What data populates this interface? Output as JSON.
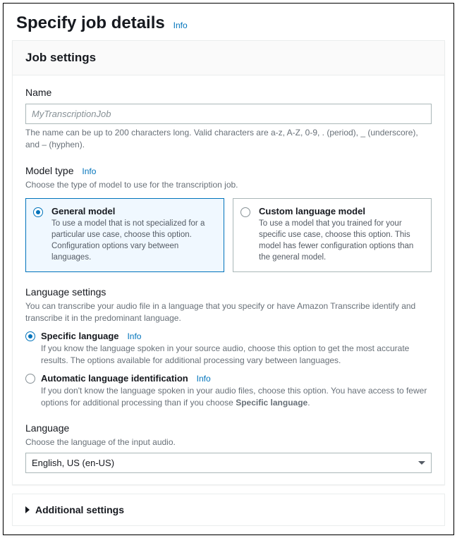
{
  "header": {
    "title": "Specify job details",
    "info": "Info"
  },
  "panel": {
    "title": "Job settings",
    "name": {
      "label": "Name",
      "placeholder": "MyTranscriptionJob",
      "hint": "The name can be up to 200 characters long. Valid characters are a-z, A-Z, 0-9, . (period), _ (underscore), and – (hyphen)."
    },
    "modelType": {
      "label": "Model type",
      "info": "Info",
      "hint": "Choose the type of model to use for the transcription job.",
      "options": [
        {
          "title": "General model",
          "desc": "To use a model that is not specialized for a particular use case, choose this option. Configuration options vary between languages."
        },
        {
          "title": "Custom language model",
          "desc": "To use a model that you trained for your specific use case, choose this option. This model has fewer configuration options than the general model."
        }
      ]
    },
    "languageSettings": {
      "label": "Language settings",
      "hint": "You can transcribe your audio file in a language that you specify or have Amazon Transcribe identify and transcribe it in the predominant language.",
      "options": [
        {
          "title": "Specific language",
          "info": "Info",
          "desc": "If you know the language spoken in your source audio, choose this option to get the most accurate results. The options available for additional processing vary between languages."
        },
        {
          "title": "Automatic language identification",
          "info": "Info",
          "descPrefix": "If you don't know the language spoken in your audio files, choose this option. You have access to fewer options for additional processing than if you choose ",
          "descBold": "Specific language",
          "descSuffix": "."
        }
      ]
    },
    "language": {
      "label": "Language",
      "hint": "Choose the language of the input audio.",
      "value": "English, US (en-US)"
    }
  },
  "expander": {
    "title": "Additional settings"
  }
}
